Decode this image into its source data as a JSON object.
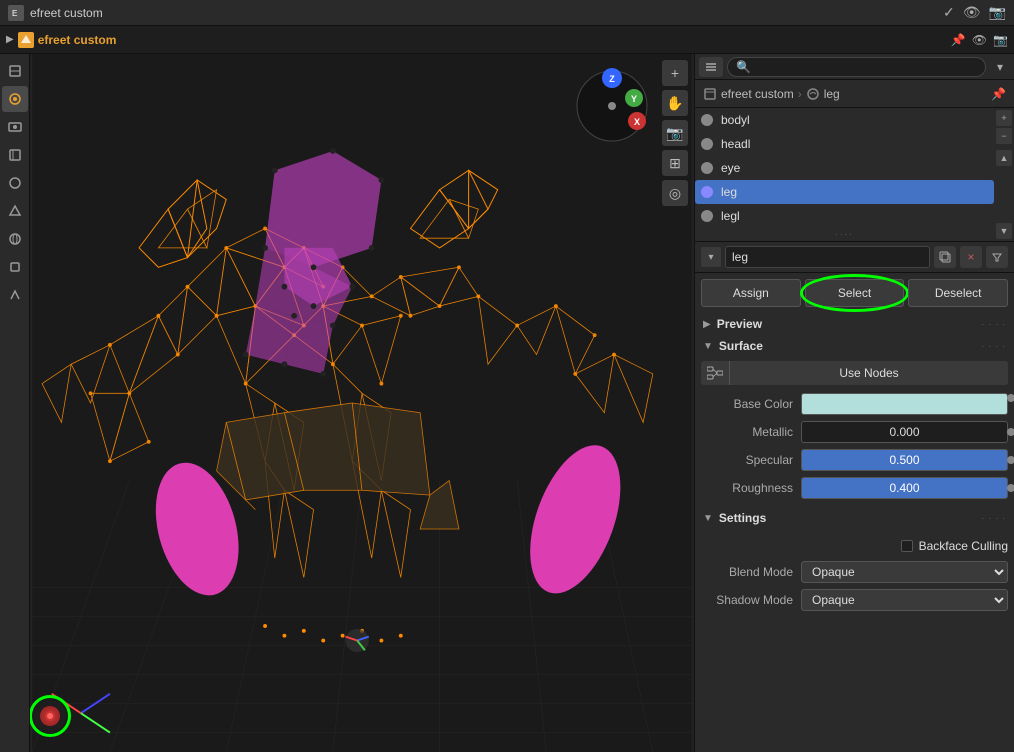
{
  "window": {
    "title": "efreet custom"
  },
  "topbar": {
    "title": "efreet custom",
    "icons": [
      "check-icon",
      "eye-icon",
      "camera-icon"
    ]
  },
  "breadcrumb": {
    "items": [
      "efreet custom",
      "leg"
    ]
  },
  "search": {
    "placeholder": ""
  },
  "materials": {
    "items": [
      {
        "name": "bodyl",
        "color": "#888"
      },
      {
        "name": "headl",
        "color": "#888"
      },
      {
        "name": "eye",
        "color": "#888"
      },
      {
        "name": "leg",
        "color": "#4472c4",
        "selected": true
      },
      {
        "name": "legl",
        "color": "#888"
      }
    ]
  },
  "mat_slot": {
    "value": "leg"
  },
  "buttons": {
    "assign": "Assign",
    "select": "Select",
    "deselect": "Deselect"
  },
  "preview": {
    "label": "Preview"
  },
  "surface": {
    "label": "Surface",
    "use_nodes": "Use Nodes",
    "base_color_label": "Base Color",
    "metallic_label": "Metallic",
    "metallic_value": "0.000",
    "specular_label": "Specular",
    "specular_value": "0.500",
    "roughness_label": "Roughness",
    "roughness_value": "0.400"
  },
  "settings": {
    "label": "Settings",
    "backface_culling": "Backface Culling",
    "blend_mode_label": "Blend Mode",
    "blend_mode_value": "Opaque",
    "shadow_mode_label": "Shadow Mode",
    "shadow_mode_value": "Opaque"
  },
  "clip_bar": {
    "title": "efreet custom",
    "material_icon": "▼"
  },
  "sidebar": {
    "icons": [
      "tool-icon",
      "scene-icon",
      "render-icon",
      "output-icon",
      "view-icon",
      "object-icon",
      "modifier-icon",
      "constraint-icon",
      "data-icon"
    ]
  },
  "viewport_toolbar": {
    "zoom_icon": "+",
    "pan_icon": "✋",
    "camera_icon": "📷",
    "grid_icon": "⊞",
    "layer_icon": "◎"
  }
}
